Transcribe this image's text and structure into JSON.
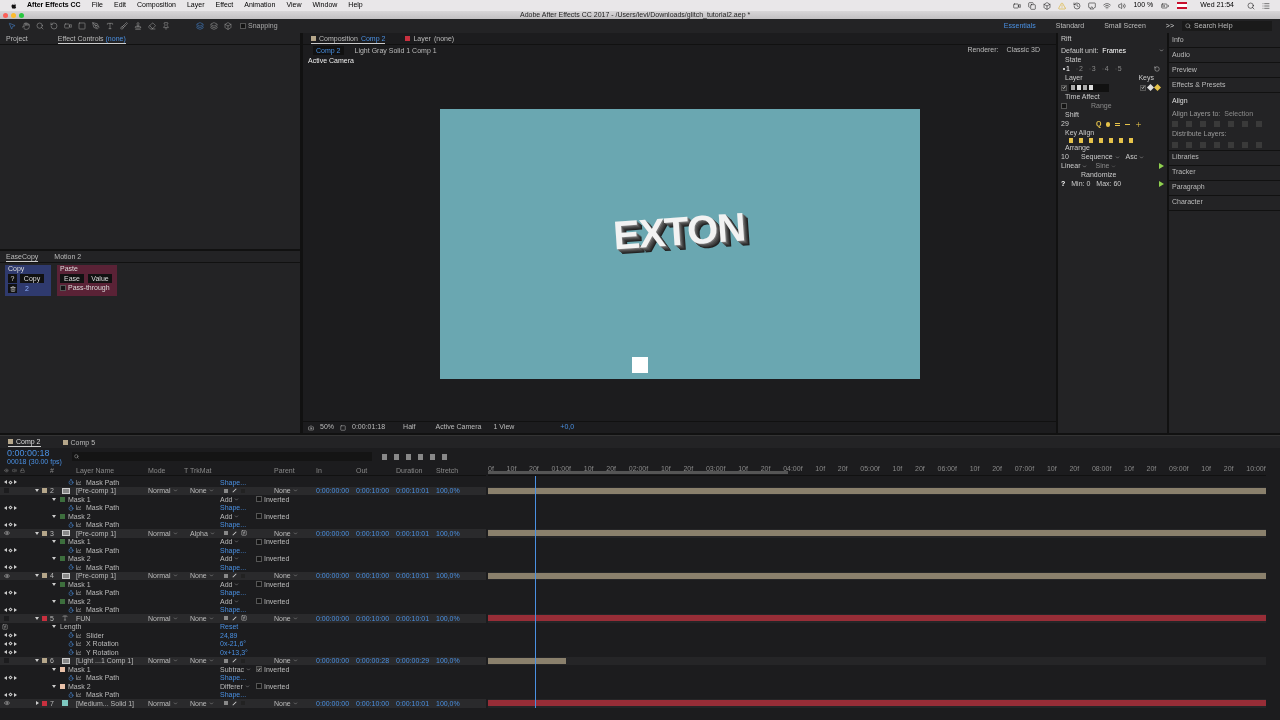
{
  "menubar": {
    "items": [
      "After Effects CC",
      "File",
      "Edit",
      "Composition",
      "Layer",
      "Effect",
      "Animation",
      "View",
      "Window",
      "Help"
    ],
    "battery": "100 %",
    "clock": "Wed 21:54"
  },
  "window": {
    "title": "Adobe After Effects CC 2017 - /Users/levi/Downloads/glitch_tutorial2.aep *"
  },
  "toolbar": {
    "snapping": {
      "label": "Snapping",
      "checked": false
    },
    "workspaces": [
      {
        "label": "Essentials",
        "selected": true
      },
      {
        "label": "Standard",
        "selected": false
      },
      {
        "label": "Small Screen",
        "selected": false
      }
    ],
    "more": ">>",
    "search": {
      "placeholder": "Search Help"
    }
  },
  "left_panel": {
    "tabs": [
      {
        "label": "Project",
        "selected": false
      },
      {
        "label": "Effect Controls",
        "suffix": "(none)",
        "selected": true
      }
    ]
  },
  "easecopy": {
    "tabs": [
      {
        "label": "EaseCopy",
        "selected": true
      },
      {
        "label": "Motion 2",
        "selected": false
      }
    ],
    "copy_title": "Copy",
    "help": "?",
    "copy_button": "Copy",
    "count": "2",
    "paste_title": "Paste",
    "ease": "Ease",
    "value": "Value",
    "pass_through": {
      "label": "Pass-through",
      "checked": false
    }
  },
  "viewer": {
    "tabs": [
      {
        "label": "Composition",
        "name": "Comp 2",
        "selected": true
      },
      {
        "label": "Layer",
        "name": "(none)",
        "selected": false
      }
    ],
    "breadcrumbs": [
      {
        "label": "Comp 2",
        "selected": true
      },
      {
        "label": "Light Gray Solid 1 Comp 1",
        "selected": false
      }
    ],
    "renderer_label": "Renderer:",
    "renderer": "Classic 3D",
    "camera_label": "Active Camera",
    "canvas_text": "EXTON",
    "zoom": "50%",
    "time": "0:00:01:18",
    "resolution": "Half",
    "camera": "Active Camera",
    "views": "1 View",
    "exposure": "+0,0"
  },
  "rift": {
    "title": "Rift",
    "default_unit_label": "Default unit:",
    "default_unit": "Frames",
    "state_label": "State",
    "states": [
      {
        "label": "1",
        "selected": true
      },
      {
        "label": "2",
        "selected": false
      },
      {
        "label": "3",
        "selected": false
      },
      {
        "label": "4",
        "selected": false
      },
      {
        "label": "5",
        "selected": false
      }
    ],
    "layer_label": "Layer",
    "layer_checked": true,
    "keys_label": "Keys",
    "keys_checked": true,
    "time_affect_label": "Time Affect",
    "time_affect_checked": false,
    "range": "Range",
    "shift_label": "Shift",
    "shift_value": "29",
    "q": "Q",
    "key_align_label": "Key Align",
    "arrange_label": "Arrange",
    "arrange_value": "10",
    "order": "Sequence",
    "direction": "Asc",
    "interpolation": "Linear",
    "ease": "Sine",
    "randomize_label": "Randomize",
    "help": "?",
    "min": "Min: 0",
    "max": "Max: 60"
  },
  "panels": {
    "items": [
      {
        "label": "Info",
        "expanded": false
      },
      {
        "label": "Audio",
        "expanded": false
      },
      {
        "label": "Preview",
        "expanded": false
      },
      {
        "label": "Effects & Presets",
        "expanded": false
      },
      {
        "label": "Align",
        "expanded": true
      },
      {
        "label": "Libraries",
        "expanded": false
      },
      {
        "label": "Tracker",
        "expanded": false
      },
      {
        "label": "Paragraph",
        "expanded": false
      },
      {
        "label": "Character",
        "expanded": false
      }
    ],
    "align_to_label": "Align Layers to:",
    "align_to": "Selection",
    "distribute_label": "Distribute Layers:"
  },
  "timeline": {
    "tabs": [
      {
        "label": "Comp 2",
        "selected": true
      },
      {
        "label": "Comp 5",
        "selected": false
      }
    ],
    "time": "0:00:00:18",
    "fps": "00018 (30.00 fps)",
    "columns": {
      "number": "#",
      "name": "Layer Name",
      "mode": "Mode",
      "t": "T",
      "trkmat": "TrkMat",
      "parent": "Parent",
      "in": "In",
      "out": "Out",
      "duration": "Duration",
      "stretch": "Stretch"
    },
    "ruler": [
      "0f",
      "10f",
      "20f",
      "01:00f",
      "10f",
      "20f",
      "02:00f",
      "10f",
      "20f",
      "03:00f",
      "10f",
      "20f",
      "04:00f",
      "10f",
      "20f",
      "05:00f",
      "10f",
      "20f",
      "06:00f",
      "10f",
      "20f",
      "07:00f",
      "10f",
      "20f",
      "08:00f",
      "10f",
      "20f",
      "09:00f",
      "10f",
      "20f",
      "10:00f"
    ],
    "playhead": {
      "level": 0.06
    },
    "work_area": {
      "level": 0.385
    },
    "rows": [
      {
        "kind": "property",
        "name": "Mask Path",
        "value": "Shape..."
      },
      {
        "kind": "precomp",
        "number": "2",
        "name": "[Pre-comp 1]",
        "mode": "Normal",
        "trkmat": "None",
        "parent": "None",
        "in": "0:00:00:00",
        "out": "0:00:10:00",
        "duration": "0:00:10:01",
        "stretch": "100,0%",
        "color": "#b5a68a",
        "visible": false,
        "expanded": true,
        "fx": false,
        "level": 1
      },
      {
        "kind": "mask",
        "name": "Mask 1",
        "mode": "Add",
        "inverted": false,
        "inverted_label": "Inverted",
        "color": "#3d6e3d"
      },
      {
        "kind": "property",
        "name": "Mask Path",
        "value": "Shape..."
      },
      {
        "kind": "mask",
        "name": "Mask 2",
        "mode": "Add",
        "inverted": false,
        "inverted_label": "Inverted",
        "color": "#3d6e3d"
      },
      {
        "kind": "property",
        "name": "Mask Path",
        "value": "Shape..."
      },
      {
        "kind": "precomp",
        "number": "3",
        "name": "[Pre-comp 1]",
        "mode": "Normal",
        "trkmat": "Alpha",
        "parent": "None",
        "in": "0:00:00:00",
        "out": "0:00:10:00",
        "duration": "0:00:10:01",
        "stretch": "100,0%",
        "color": "#b5a68a",
        "visible": true,
        "expanded": true,
        "fx": true,
        "level": 1
      },
      {
        "kind": "mask",
        "name": "Mask 1",
        "mode": "Add",
        "inverted": false,
        "inverted_label": "Inverted",
        "color": "#3d6e3d"
      },
      {
        "kind": "property",
        "name": "Mask Path",
        "value": "Shape..."
      },
      {
        "kind": "mask",
        "name": "Mask 2",
        "mode": "Add",
        "inverted": false,
        "inverted_label": "Inverted",
        "color": "#3d6e3d"
      },
      {
        "kind": "property",
        "name": "Mask Path",
        "value": "Shape..."
      },
      {
        "kind": "precomp",
        "number": "4",
        "name": "[Pre-comp 1]",
        "mode": "Normal",
        "trkmat": "None",
        "parent": "None",
        "in": "0:00:00:00",
        "out": "0:00:10:00",
        "duration": "0:00:10:01",
        "stretch": "100,0%",
        "color": "#b5a68a",
        "visible": true,
        "expanded": true,
        "fx": false,
        "level": 1
      },
      {
        "kind": "mask",
        "name": "Mask 1",
        "mode": "Add",
        "inverted": false,
        "inverted_label": "Inverted",
        "color": "#3d6e3d"
      },
      {
        "kind": "property",
        "name": "Mask Path",
        "value": "Shape..."
      },
      {
        "kind": "mask",
        "name": "Mask 2",
        "mode": "Add",
        "inverted": false,
        "inverted_label": "Inverted",
        "color": "#3d6e3d"
      },
      {
        "kind": "property",
        "name": "Mask Path",
        "value": "Shape..."
      },
      {
        "kind": "text",
        "number": "5",
        "name": "FUN",
        "mode": "Normal",
        "trkmat": "None",
        "parent": "None",
        "in": "0:00:00:00",
        "out": "0:00:10:00",
        "duration": "0:00:10:01",
        "stretch": "100,0%",
        "color": "#c8303f",
        "visible": false,
        "expanded": true,
        "fx": true,
        "level": 1
      },
      {
        "kind": "effect",
        "name": "Length",
        "value": "Reset"
      },
      {
        "kind": "property",
        "name": "Slider",
        "value": "24,89"
      },
      {
        "kind": "property",
        "name": "X Rotation",
        "value": "0x-21,6°"
      },
      {
        "kind": "property",
        "name": "Y Rotation",
        "value": "0x+13,3°"
      },
      {
        "kind": "precomp",
        "number": "6",
        "name": "[Light ...1 Comp 1]",
        "mode": "Normal",
        "trkmat": "None",
        "parent": "None",
        "in": "0:00:00:00",
        "out": "0:00:00:28",
        "duration": "0:00:00:29",
        "stretch": "100,0%",
        "color": "#b5a68a",
        "visible": false,
        "expanded": true,
        "fx": false,
        "level": 0.1
      },
      {
        "kind": "mask",
        "name": "Mask 1",
        "mode": "Subtrac",
        "inverted": true,
        "inverted_label": "Inverted",
        "color": "#e8c0a8"
      },
      {
        "kind": "property",
        "name": "Mask Path",
        "value": "Shape..."
      },
      {
        "kind": "mask",
        "name": "Mask 2",
        "mode": "Differer",
        "inverted": false,
        "inverted_label": "Inverted",
        "color": "#e8c0a8"
      },
      {
        "kind": "property",
        "name": "Mask Path",
        "value": "Shape..."
      },
      {
        "kind": "solid",
        "number": "7",
        "name": "[Medium... Solid 1]",
        "mode": "Normal",
        "trkmat": "None",
        "parent": "None",
        "in": "0:00:00:00",
        "out": "0:00:10:00",
        "duration": "0:00:10:01",
        "stretch": "100,0%",
        "color": "#c8303f",
        "visible": true,
        "expanded": false,
        "fx": false,
        "level": 1
      }
    ]
  }
}
